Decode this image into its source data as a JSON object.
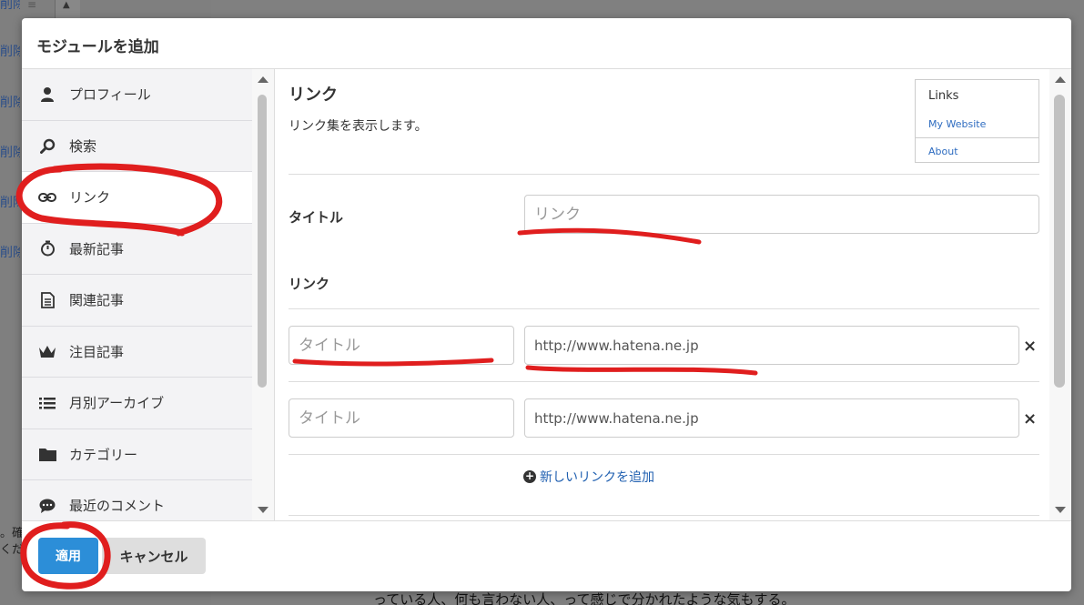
{
  "background": {
    "delete_label": "削除",
    "bottom_text": "っている人、何も言わない人、って感じで分かれたような気もする。",
    "side_text_1": "。確",
    "side_text_2": "くだ"
  },
  "modal": {
    "title": "モジュールを追加",
    "sidebar": {
      "items": [
        {
          "label": "プロフィール",
          "icon": "user-icon"
        },
        {
          "label": "検索",
          "icon": "search-icon"
        },
        {
          "label": "リンク",
          "icon": "link-icon"
        },
        {
          "label": "最新記事",
          "icon": "stopwatch-icon"
        },
        {
          "label": "関連記事",
          "icon": "document-icon"
        },
        {
          "label": "注目記事",
          "icon": "crown-icon"
        },
        {
          "label": "月別アーカイブ",
          "icon": "list-icon"
        },
        {
          "label": "カテゴリー",
          "icon": "folder-icon"
        },
        {
          "label": "最近のコメント",
          "icon": "comment-icon"
        }
      ],
      "active_index": 2
    },
    "content": {
      "title": "リンク",
      "description": "リンク集を表示します。",
      "preview": {
        "heading": "Links",
        "links": [
          "My Website",
          "About"
        ]
      },
      "title_field": {
        "label": "タイトル",
        "placeholder": "リンク"
      },
      "links_section": {
        "label": "リンク",
        "rows": [
          {
            "title_placeholder": "タイトル",
            "url_placeholder": "http://www.hatena.ne.jp"
          },
          {
            "title_placeholder": "タイトル",
            "url_placeholder": "http://www.hatena.ne.jp"
          }
        ],
        "remove_symbol": "×",
        "add_label": "新しいリンクを追加",
        "add_symbol": "+"
      }
    },
    "footer": {
      "apply_label": "適用",
      "cancel_label": "キャンセル"
    }
  },
  "colors": {
    "primary_button": "#2c8ed8",
    "link": "#1f5fb0",
    "annotation_red": "#e01e1e"
  }
}
